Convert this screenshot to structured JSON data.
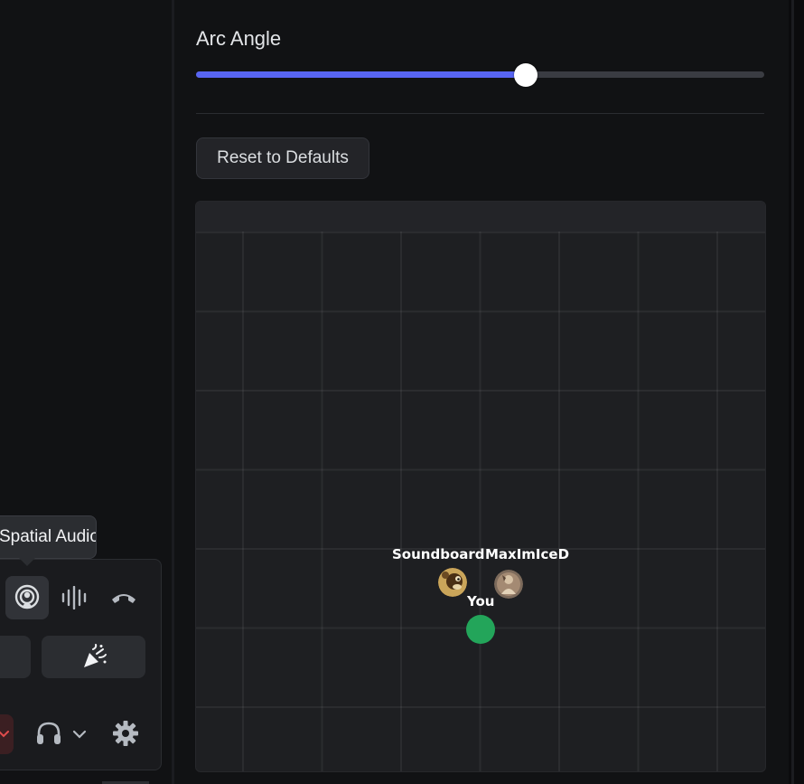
{
  "settings": {
    "arc_angle_label": "Arc Angle",
    "arc_angle_value_percent": 58,
    "reset_label": "Reset to Defaults",
    "slider_fill_color": "#5865f2"
  },
  "spatial_map": {
    "users": [
      {
        "name": "Soundboard",
        "avatar": "soundboard-avatar"
      },
      {
        "name": "MaxImIceD",
        "avatar": "maximiced-avatar"
      },
      {
        "name": "You",
        "marker_color": "#23a55a"
      }
    ]
  },
  "voice_controls": {
    "tooltip": "Spatial Audio",
    "buttons": [
      "spatial-audio-icon",
      "waveform-icon",
      "hang-up-icon",
      "soundboard-icon",
      "mute-chevron-icon",
      "headphones-icon",
      "chevron-down-icon",
      "gear-icon"
    ]
  }
}
